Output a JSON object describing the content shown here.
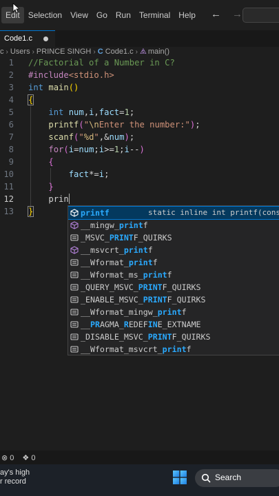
{
  "menubar": {
    "items": [
      "Edit",
      "Selection",
      "View",
      "Go",
      "Run",
      "Terminal",
      "Help"
    ]
  },
  "tab": {
    "label": "Code1.c"
  },
  "breadcrumb": {
    "seg1": "c",
    "seg2": "Users",
    "seg3": "PRINCE SINGH",
    "file_badge": "C",
    "file": "Code1.c",
    "symbol": "main()"
  },
  "editor": {
    "line_numbers": [
      "1",
      "2",
      "3",
      "4",
      "5",
      "6",
      "7",
      "8",
      "9",
      "10",
      "11",
      "12",
      "13"
    ],
    "current_line": 12,
    "lines": [
      {
        "indent": "",
        "parts": [
          [
            "c-com",
            "//Factorial of a Number in C?"
          ]
        ]
      },
      {
        "indent": "",
        "parts": [
          [
            "c-inc",
            "#include"
          ],
          [
            "c-str",
            "<stdio.h>"
          ]
        ]
      },
      {
        "indent": "",
        "parts": [
          [
            "c-kw",
            "int"
          ],
          [
            "c-txt",
            " "
          ],
          [
            "c-fn",
            "main"
          ],
          [
            "c-brk",
            "()"
          ]
        ]
      },
      {
        "indent": "",
        "parts": [
          [
            "c-brk brace-box",
            "{"
          ]
        ]
      },
      {
        "indent": "    ",
        "parts": [
          [
            "c-kw",
            "int"
          ],
          [
            "c-txt",
            " "
          ],
          [
            "c-var",
            "num"
          ],
          [
            "c-txt",
            ","
          ],
          [
            "c-var",
            "i"
          ],
          [
            "c-txt",
            ","
          ],
          [
            "c-var",
            "fact"
          ],
          [
            "c-txt",
            "="
          ],
          [
            "c-num",
            "1"
          ],
          [
            "c-txt",
            ";"
          ]
        ]
      },
      {
        "indent": "    ",
        "parts": [
          [
            "c-fn",
            "printf"
          ],
          [
            "c-brk2",
            "("
          ],
          [
            "c-str",
            "\""
          ],
          [
            "c-esc",
            "\\n"
          ],
          [
            "c-str",
            "Enter the number:\""
          ],
          [
            "c-brk2",
            ")"
          ],
          [
            "c-txt",
            ";"
          ]
        ]
      },
      {
        "indent": "    ",
        "parts": [
          [
            "c-fn",
            "scanf"
          ],
          [
            "c-brk2",
            "("
          ],
          [
            "c-str",
            "\""
          ],
          [
            "c-esc",
            "%d"
          ],
          [
            "c-str",
            "\""
          ],
          [
            "c-txt",
            ",&"
          ],
          [
            "c-var",
            "num"
          ],
          [
            "c-brk2",
            ")"
          ],
          [
            "c-txt",
            ";"
          ]
        ]
      },
      {
        "indent": "    ",
        "parts": [
          [
            "c-ctl",
            "for"
          ],
          [
            "c-brk2",
            "("
          ],
          [
            "c-var",
            "i"
          ],
          [
            "c-txt",
            "="
          ],
          [
            "c-var",
            "num"
          ],
          [
            "c-txt",
            ";"
          ],
          [
            "c-var",
            "i"
          ],
          [
            "c-txt",
            ">="
          ],
          [
            "c-num",
            "1"
          ],
          [
            "c-txt",
            ";"
          ],
          [
            "c-var",
            "i"
          ],
          [
            "c-txt",
            "--"
          ],
          [
            "c-brk2",
            ")"
          ]
        ]
      },
      {
        "indent": "    ",
        "parts": [
          [
            "c-brk2",
            "{"
          ]
        ]
      },
      {
        "indent": "        ",
        "parts": [
          [
            "c-var",
            "fact"
          ],
          [
            "c-txt",
            "*="
          ],
          [
            "c-var",
            "i"
          ],
          [
            "c-txt",
            ";"
          ]
        ]
      },
      {
        "indent": "    ",
        "parts": [
          [
            "c-brk2",
            "}"
          ]
        ]
      },
      {
        "indent": "    ",
        "parts": [
          [
            "c-txt",
            "prin"
          ]
        ]
      },
      {
        "indent": "",
        "parts": [
          [
            "c-brk brace-box",
            "}"
          ]
        ]
      }
    ]
  },
  "suggest": {
    "items": [
      {
        "icon": "cube-icon",
        "label": [
          [
            "hl",
            "printf"
          ]
        ],
        "detail": "static inline int printf(const",
        "selected": true
      },
      {
        "icon": "cube-icon",
        "label": [
          [
            "",
            "__mingw_"
          ],
          [
            "hl",
            "print"
          ],
          [
            "",
            "f"
          ]
        ]
      },
      {
        "icon": "macro-icon",
        "label": [
          [
            "",
            "_MSVC_"
          ],
          [
            "hl",
            "PRINT"
          ],
          [
            "",
            "F_QUIRKS"
          ]
        ]
      },
      {
        "icon": "cube-icon",
        "label": [
          [
            "",
            "__msvcrt_"
          ],
          [
            "hl",
            "print"
          ],
          [
            "",
            "f"
          ]
        ]
      },
      {
        "icon": "macro-icon",
        "label": [
          [
            "",
            "__Wformat_"
          ],
          [
            "hl",
            "print"
          ],
          [
            "",
            "f"
          ]
        ]
      },
      {
        "icon": "macro-icon",
        "label": [
          [
            "",
            "__Wformat_ms_"
          ],
          [
            "hl",
            "print"
          ],
          [
            "",
            "f"
          ]
        ]
      },
      {
        "icon": "macro-icon",
        "label": [
          [
            "",
            "_QUERY_MSVC_"
          ],
          [
            "hl",
            "PRINT"
          ],
          [
            "",
            "F_QUIRKS"
          ]
        ]
      },
      {
        "icon": "macro-icon",
        "label": [
          [
            "",
            "_ENABLE_MSVC_"
          ],
          [
            "hl",
            "PRINT"
          ],
          [
            "",
            "F_QUIRKS"
          ]
        ]
      },
      {
        "icon": "macro-icon",
        "label": [
          [
            "",
            "__Wformat_mingw_"
          ],
          [
            "hl",
            "print"
          ],
          [
            "",
            "f"
          ]
        ]
      },
      {
        "icon": "macro-icon",
        "label": [
          [
            "",
            "__"
          ],
          [
            "hl",
            "PR"
          ],
          [
            "",
            "AGMA_"
          ],
          [
            "hl",
            "R"
          ],
          [
            "",
            "EDEF"
          ],
          [
            "hl",
            "IN"
          ],
          [
            "",
            "E_EXTNAME"
          ]
        ]
      },
      {
        "icon": "macro-icon",
        "label": [
          [
            "",
            "_DISABLE_MSVC_"
          ],
          [
            "hl",
            "PRINT"
          ],
          [
            "",
            "F_QUIRKS"
          ]
        ]
      },
      {
        "icon": "macro-icon",
        "label": [
          [
            "",
            "__Wformat_msvcrt_"
          ],
          [
            "hl",
            "print"
          ],
          [
            "",
            "f"
          ]
        ]
      }
    ]
  },
  "statusbar": {
    "errors": "0",
    "ports": "0"
  },
  "taskbar": {
    "news_line1": "ay's high",
    "news_line2": "r record",
    "search_label": "Search"
  },
  "colors": {
    "accent": "#0078d4",
    "highlight": "#2aaaff",
    "selection": "#04395e"
  }
}
